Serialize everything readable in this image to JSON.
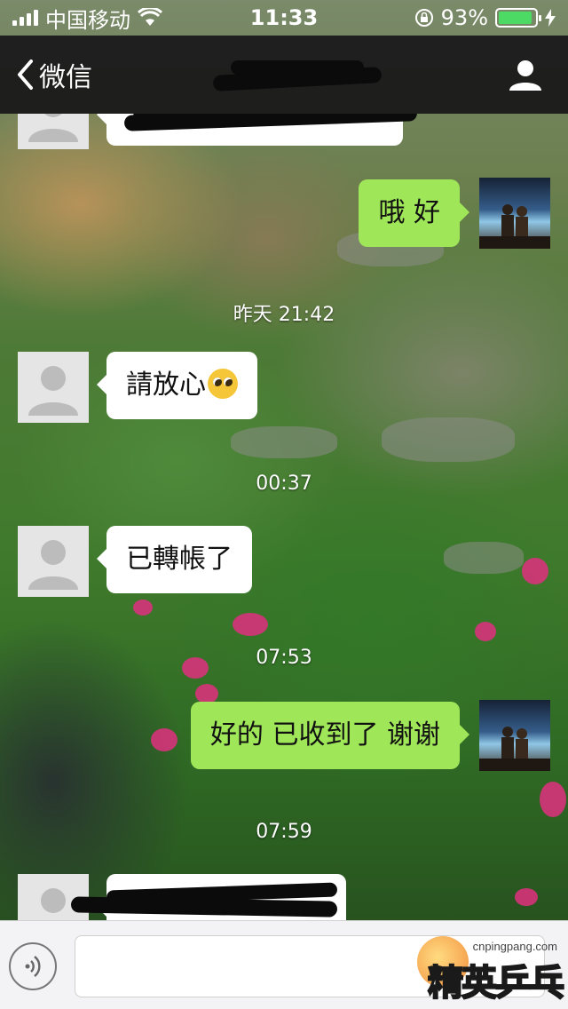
{
  "status_bar": {
    "carrier": "中国移动",
    "time": "11:33",
    "battery_percent": "93%",
    "battery_level": 0.93,
    "battery_color": "#4cd964"
  },
  "nav": {
    "back_label": "微信",
    "back_icon": "chevron-left-icon",
    "profile_icon": "person-icon"
  },
  "messages": [
    {
      "direction": "in",
      "text": "",
      "redacted": true
    },
    {
      "direction": "out",
      "text": "哦 好"
    },
    {
      "kind": "time",
      "text": "昨天 21:42"
    },
    {
      "direction": "in",
      "text": "請放心",
      "emoji": "worried-face"
    },
    {
      "kind": "time",
      "text": "00:37"
    },
    {
      "direction": "in",
      "text": "已轉帳了"
    },
    {
      "kind": "time",
      "text": "07:53"
    },
    {
      "direction": "out",
      "text": "好的 已收到了 谢谢"
    },
    {
      "kind": "time",
      "text": "07:59"
    },
    {
      "direction": "in",
      "text": "",
      "redacted": true
    }
  ],
  "input_bar": {
    "voice_icon": "voice-icon",
    "text_value": ""
  },
  "watermark": {
    "domain": "cnpingpang.com",
    "brand": "精英乒乓网"
  },
  "colors": {
    "outgoing_bubble": "#9fe658",
    "incoming_bubble": "#ffffff",
    "nav_background": "#18181a"
  }
}
